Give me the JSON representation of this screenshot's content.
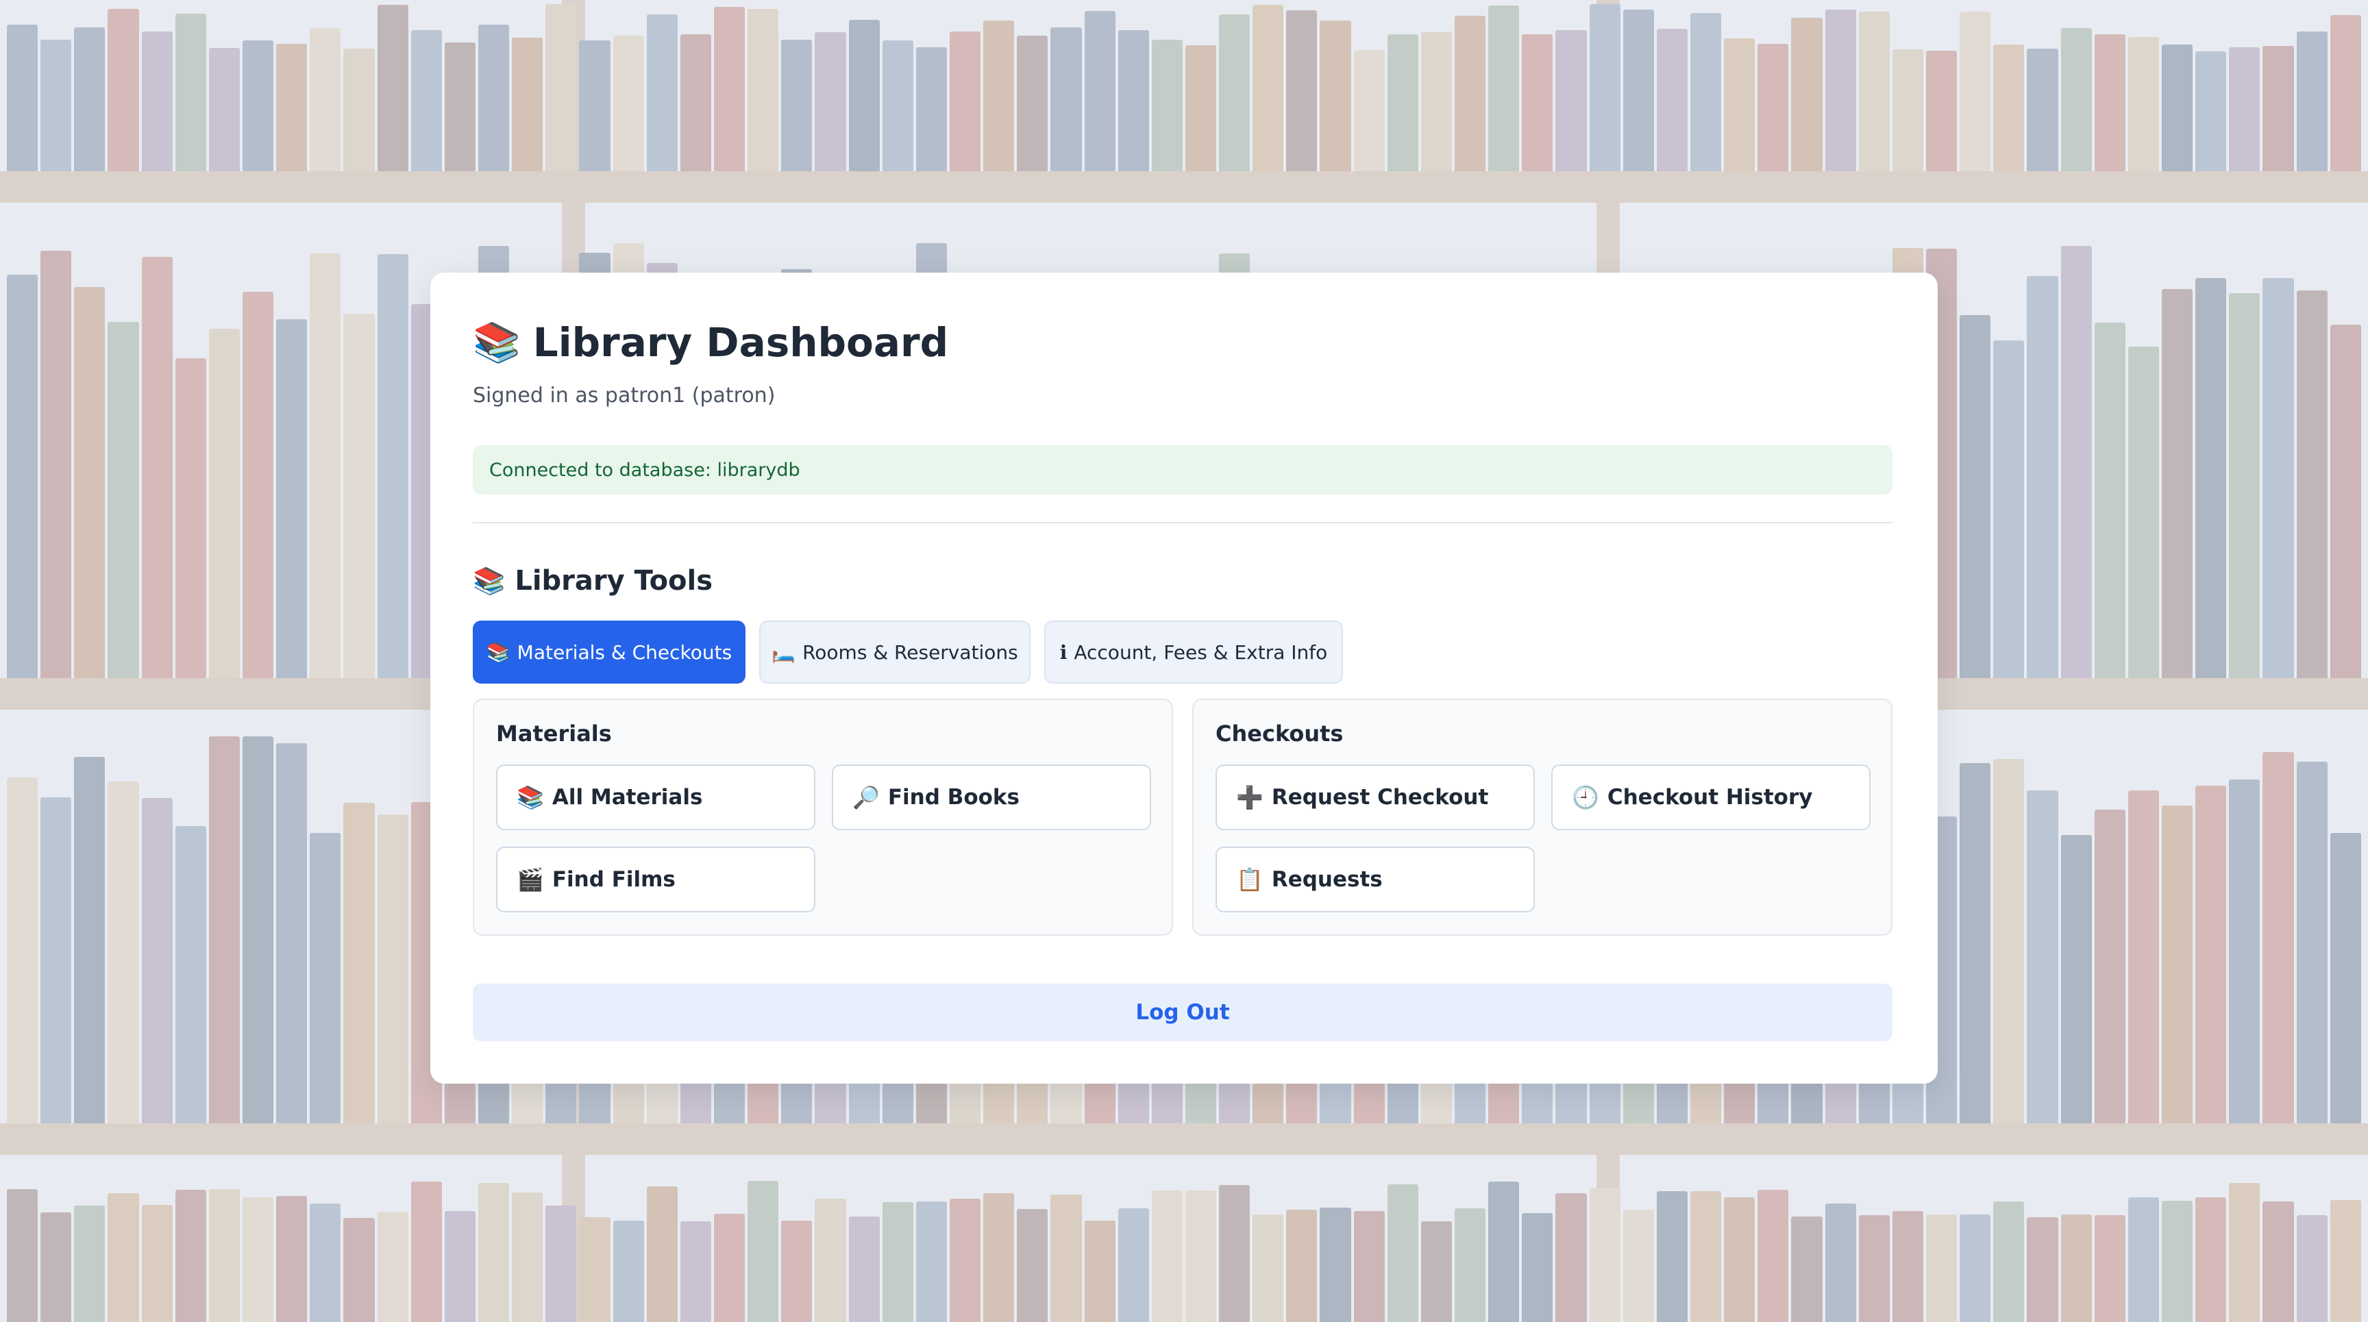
{
  "header": {
    "title_icon": "books-emoji",
    "title_icon_glyph": "📚",
    "title": "Library Dashboard",
    "signed_in": "Signed in as patron1 (patron)"
  },
  "status": {
    "text": "Connected to database: librarydb",
    "color": "#166534"
  },
  "tools": {
    "icon_glyph": "📚",
    "title": "Library Tools"
  },
  "tabs": [
    {
      "icon_glyph": "📚",
      "label": "Materials & Checkouts",
      "active": true
    },
    {
      "icon_glyph": "🛏️",
      "label": "Rooms & Reservations",
      "active": false
    },
    {
      "icon_glyph": "ℹ",
      "label": "Account, Fees & Extra Info",
      "active": false
    }
  ],
  "materials": {
    "title": "Materials",
    "buttons": [
      {
        "icon_glyph": "📚",
        "label": "All Materials"
      },
      {
        "icon_glyph": "🔎",
        "label": "Find Books"
      },
      {
        "icon_glyph": "🎬",
        "label": "Find Films"
      }
    ]
  },
  "checkouts": {
    "title": "Checkouts",
    "buttons": [
      {
        "icon_glyph": "➕",
        "label": "Request Checkout"
      },
      {
        "icon_glyph": "🕘",
        "label": "Checkout History"
      },
      {
        "icon_glyph": "📋",
        "label": "Requests"
      }
    ]
  },
  "logout_label": "Log Out",
  "colors": {
    "accent": "#2563eb",
    "status_bg": "#e8f6ec"
  }
}
